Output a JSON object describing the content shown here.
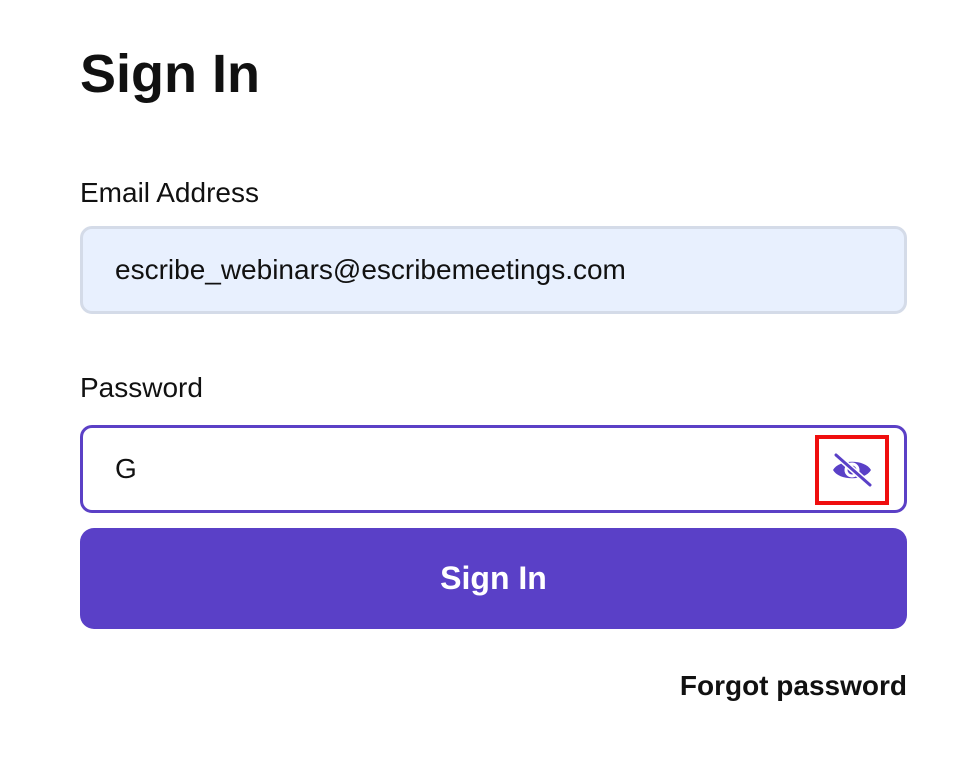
{
  "form": {
    "title": "Sign In",
    "email": {
      "label": "Email Address",
      "value": "escribe_webinars@escribemeetings.com"
    },
    "password": {
      "label": "Password",
      "value": "G",
      "toggle_icon": "eye-slash-icon"
    },
    "submit_label": "Sign In",
    "forgot_password_label": "Forgot password"
  },
  "colors": {
    "accent": "#5a40c7",
    "focus_border": "#5b40c6",
    "autofill_background": "#e8f0fe",
    "highlight_box": "#ef0e0e"
  }
}
